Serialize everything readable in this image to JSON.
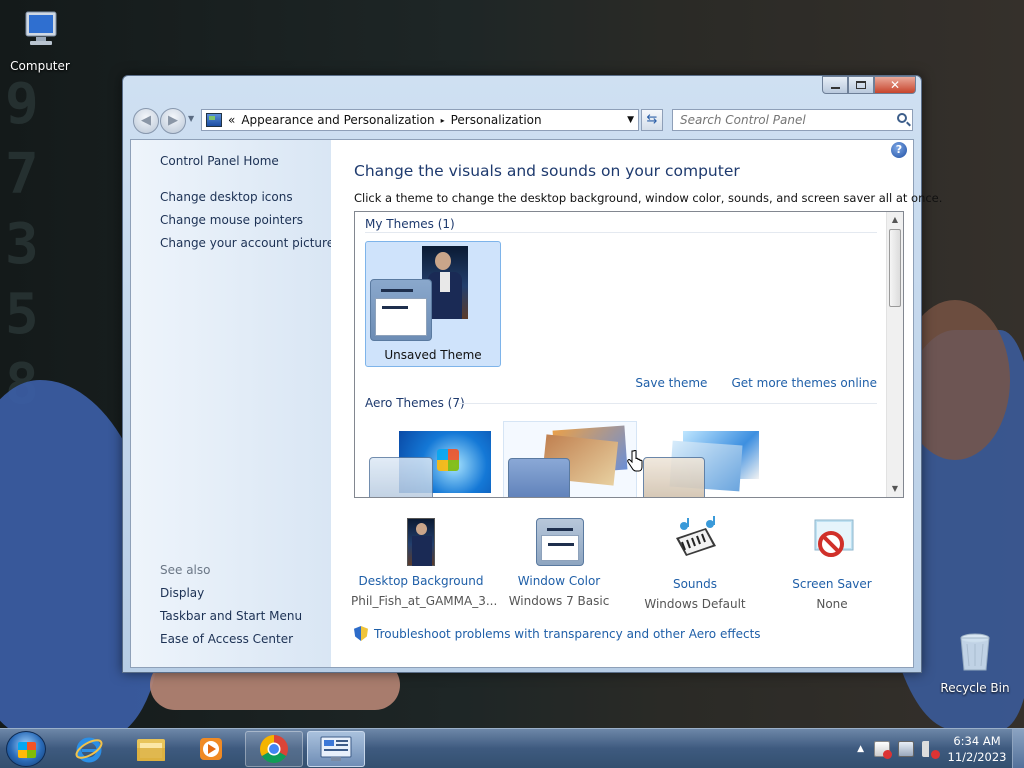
{
  "desktop": {
    "icons": [
      {
        "label": "Computer"
      },
      {
        "label": "Recycle Bin"
      }
    ]
  },
  "window": {
    "nav": {
      "back_icon": "back-arrow-icon",
      "forward_icon": "forward-arrow-icon",
      "address_prefix": "«",
      "breadcrumb": [
        "Appearance and Personalization",
        "Personalization"
      ],
      "breadcrumb_sep": "▸",
      "search_placeholder": "Search Control Panel"
    },
    "sidebar": {
      "home": "Control Panel Home",
      "links": [
        "Change desktop icons",
        "Change mouse pointers",
        "Change your account picture"
      ],
      "see_also_title": "See also",
      "see_also": [
        "Display",
        "Taskbar and Start Menu",
        "Ease of Access Center"
      ]
    },
    "main": {
      "title": "Change the visuals and sounds on your computer",
      "subtitle": "Click a theme to change the desktop background, window color, sounds, and screen saver all at once.",
      "my_themes_header": "My Themes (1)",
      "unsaved_theme": "Unsaved Theme",
      "save_theme": "Save theme",
      "get_more_themes": "Get more themes online",
      "aero_themes_header": "Aero Themes (7)",
      "items": [
        {
          "label": "Desktop Background",
          "value": "Phil_Fish_at_GAMMA_3..."
        },
        {
          "label": "Window Color",
          "value": "Windows 7 Basic"
        },
        {
          "label": "Sounds",
          "value": "Windows Default"
        },
        {
          "label": "Screen Saver",
          "value": "None"
        }
      ],
      "troubleshoot": "Troubleshoot problems with transparency and other Aero effects"
    }
  },
  "taskbar": {
    "time": "6:34 AM",
    "date": "11/2/2023"
  },
  "colors": {
    "link": "#1f5fa8",
    "heading": "#1e3a6e",
    "selection": "#cfe3fb"
  }
}
